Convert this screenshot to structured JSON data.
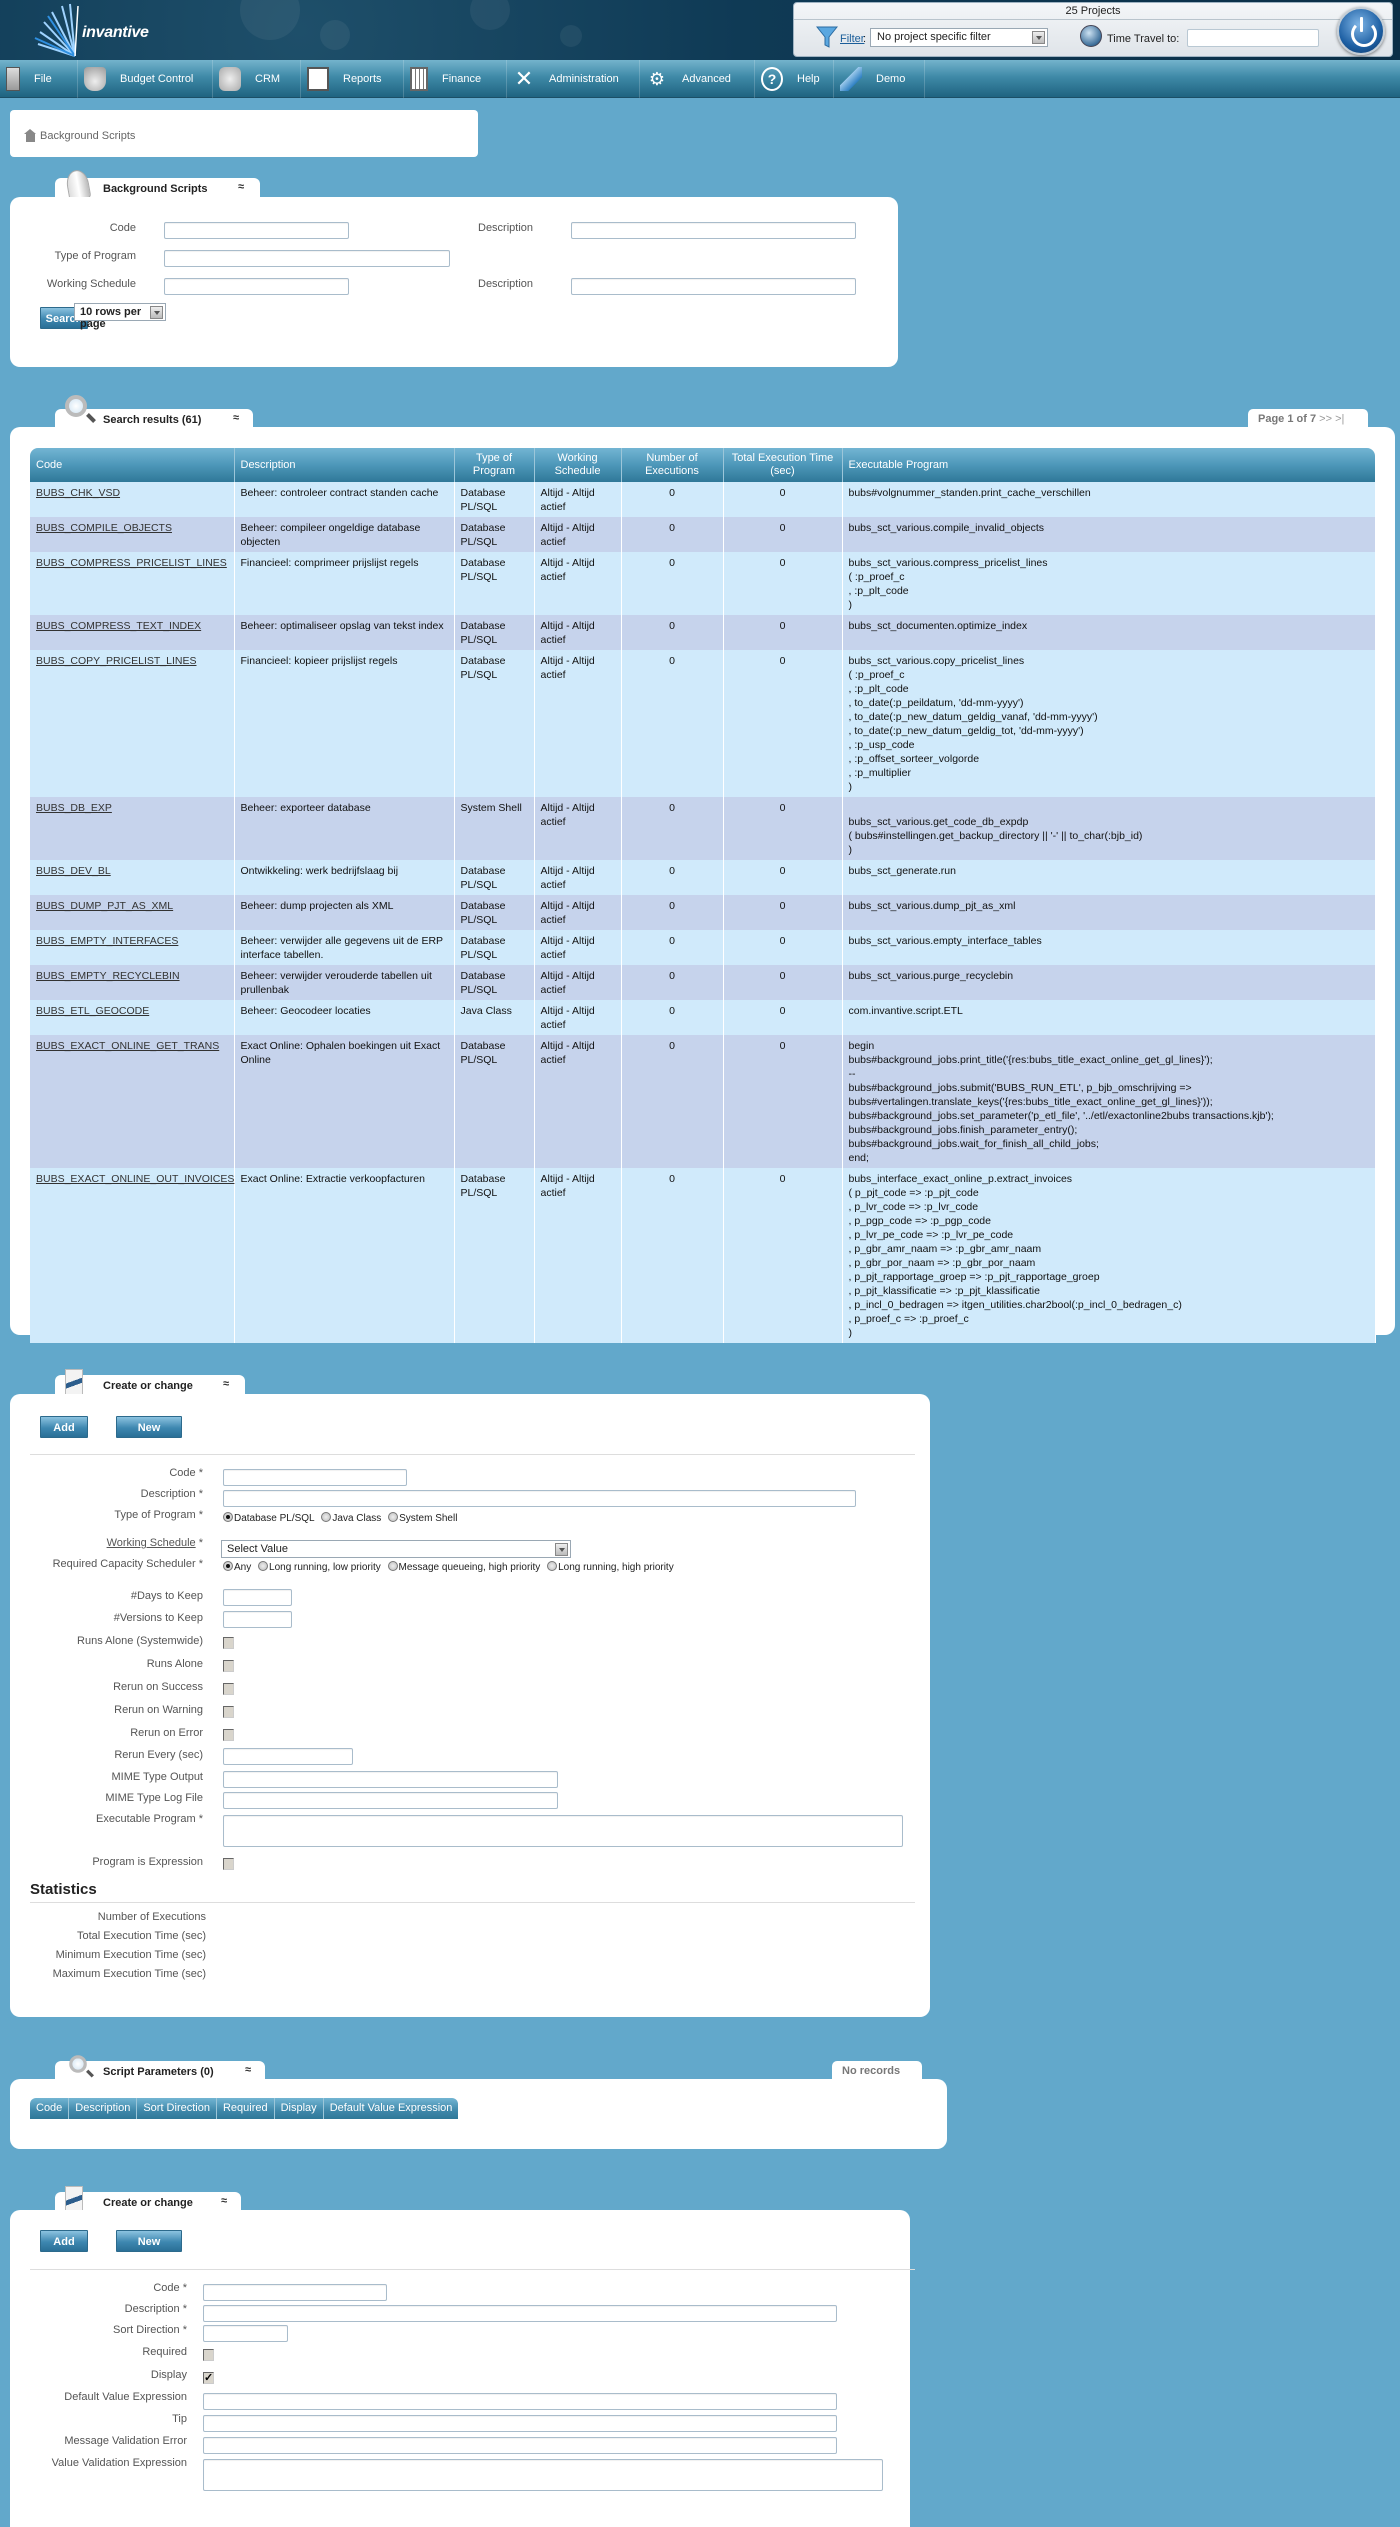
{
  "header": {
    "logo_text": "invantive",
    "projects_count": "25 Projects",
    "filter_label": "Filter",
    "filter_colon": ":",
    "filter_value": "No project specific filter",
    "time_travel_label": "Time Travel to:",
    "time_travel_value": ""
  },
  "nav": {
    "items": [
      {
        "label": "File",
        "icon": "file-cabinet-icon"
      },
      {
        "label": "Budget Control",
        "icon": "money-bag-icon"
      },
      {
        "label": "CRM",
        "icon": "handshake-icon"
      },
      {
        "label": "Reports",
        "icon": "presentation-chart-icon"
      },
      {
        "label": "Finance",
        "icon": "calculator-icon"
      },
      {
        "label": "Administration",
        "icon": "tools-icon"
      },
      {
        "label": "Advanced",
        "icon": "gears-icon"
      },
      {
        "label": "Help",
        "icon": "help-icon"
      },
      {
        "label": "Demo",
        "icon": "demo-logo-icon"
      }
    ]
  },
  "breadcrumb": {
    "label": "Background Scripts"
  },
  "search_panel": {
    "tab_title": "Background Scripts",
    "collapse": "≈",
    "fields": {
      "code_label": "Code",
      "code_value": "",
      "description_label": "Description",
      "description_value": "",
      "type_label": "Type of Program",
      "type_value": "",
      "schedule_label": "Working Schedule",
      "schedule_value": "",
      "schedule_desc_label": "Description",
      "schedule_desc_value": ""
    },
    "search_button": "Search",
    "rows_per_page": "10 rows per page"
  },
  "results": {
    "tab_title": "Search results (61)",
    "collapse": "≈",
    "pager_text": "Page 1 of 7",
    "pager_next": ">>",
    "pager_last": ">|",
    "columns": [
      "Code",
      "Description",
      "Type of Program",
      "Working Schedule",
      "Number of Executions",
      "Total Execution Time (sec)",
      "Executable Program"
    ],
    "rows": [
      {
        "code": "BUBS_CHK_VSD",
        "description": "Beheer: controleer contract standen cache",
        "type": "Database PL/SQL",
        "schedule": "Altijd - Altijd actief",
        "executions": "0",
        "total_time": "0",
        "program": [
          "bubs#volgnummer_standen.print_cache_verschillen"
        ]
      },
      {
        "code": "BUBS_COMPILE_OBJECTS",
        "description": "Beheer: compileer ongeldige database objecten",
        "type": "Database PL/SQL",
        "schedule": "Altijd - Altijd actief",
        "executions": "0",
        "total_time": "0",
        "program": [
          "bubs_sct_various.compile_invalid_objects"
        ]
      },
      {
        "code": "BUBS_COMPRESS_PRICELIST_LINES",
        "description": "Financieel: comprimeer prijslijst regels",
        "type": "Database PL/SQL",
        "schedule": "Altijd - Altijd actief",
        "executions": "0",
        "total_time": "0",
        "program": [
          "bubs_sct_various.compress_pricelist_lines",
          "( :p_proef_c",
          ", :p_plt_code",
          ")"
        ]
      },
      {
        "code": "BUBS_COMPRESS_TEXT_INDEX",
        "description": "Beheer: optimaliseer opslag van tekst index",
        "type": "Database PL/SQL",
        "schedule": "Altijd - Altijd actief",
        "executions": "0",
        "total_time": "0",
        "program": [
          "bubs_sct_documenten.optimize_index"
        ]
      },
      {
        "code": "BUBS_COPY_PRICELIST_LINES",
        "description": "Financieel: kopieer prijslijst regels",
        "type": "Database PL/SQL",
        "schedule": "Altijd - Altijd actief",
        "executions": "0",
        "total_time": "0",
        "program": [
          "bubs_sct_various.copy_pricelist_lines",
          "( :p_proef_c",
          ", :p_plt_code",
          ", to_date(:p_peildatum, 'dd-mm-yyyy')",
          ", to_date(:p_new_datum_geldig_vanaf, 'dd-mm-yyyy')",
          ", to_date(:p_new_datum_geldig_tot, 'dd-mm-yyyy')",
          ", :p_usp_code",
          ", :p_offset_sorteer_volgorde",
          ", :p_multiplier",
          ")"
        ]
      },
      {
        "code": "BUBS_DB_EXP",
        "description": "Beheer: exporteer database",
        "type": "System Shell",
        "schedule": "Altijd - Altijd actief",
        "executions": "0",
        "total_time": "0",
        "program": [
          "",
          "bubs_sct_various.get_code_db_expdp",
          "( bubs#instellingen.get_backup_directory || '-' || to_char(:bjb_id)",
          ")"
        ]
      },
      {
        "code": "BUBS_DEV_BL",
        "description": "Ontwikkeling: werk bedrijfslaag bij",
        "type": "Database PL/SQL",
        "schedule": "Altijd - Altijd actief",
        "executions": "0",
        "total_time": "0",
        "program": [
          "bubs_sct_generate.run"
        ]
      },
      {
        "code": "BUBS_DUMP_PJT_AS_XML",
        "description": "Beheer: dump projecten als XML",
        "type": "Database PL/SQL",
        "schedule": "Altijd - Altijd actief",
        "executions": "0",
        "total_time": "0",
        "program": [
          "bubs_sct_various.dump_pjt_as_xml"
        ]
      },
      {
        "code": "BUBS_EMPTY_INTERFACES",
        "description": "Beheer: verwijder alle gegevens uit de ERP interface tabellen.",
        "type": "Database PL/SQL",
        "schedule": "Altijd - Altijd actief",
        "executions": "0",
        "total_time": "0",
        "program": [
          "bubs_sct_various.empty_interface_tables"
        ]
      },
      {
        "code": "BUBS_EMPTY_RECYCLEBIN",
        "description": "Beheer: verwijder verouderde tabellen uit prullenbak",
        "type": "Database PL/SQL",
        "schedule": "Altijd - Altijd actief",
        "executions": "0",
        "total_time": "0",
        "program": [
          "bubs_sct_various.purge_recyclebin"
        ]
      },
      {
        "code": "BUBS_ETL_GEOCODE",
        "description": "Beheer: Geocodeer locaties",
        "type": "Java Class",
        "schedule": "Altijd - Altijd actief",
        "executions": "0",
        "total_time": "0",
        "program": [
          "com.invantive.script.ETL"
        ]
      },
      {
        "code": "BUBS_EXACT_ONLINE_GET_TRANS",
        "description": "Exact Online: Ophalen boekingen uit Exact Online",
        "type": "Database PL/SQL",
        "schedule": "Altijd - Altijd actief",
        "executions": "0",
        "total_time": "0",
        "program": [
          "begin",
          "bubs#background_jobs.print_title('{res:bubs_title_exact_online_get_gl_lines}');",
          "--",
          "bubs#background_jobs.submit('BUBS_RUN_ETL', p_bjb_omschrijving =>",
          "bubs#vertalingen.translate_keys('{res:bubs_title_exact_online_get_gl_lines}'));",
          "bubs#background_jobs.set_parameter('p_etl_file', '../etl/exactonline2bubs transactions.kjb');",
          "bubs#background_jobs.finish_parameter_entry();",
          "bubs#background_jobs.wait_for_finish_all_child_jobs;",
          "end;"
        ]
      },
      {
        "code": "BUBS_EXACT_ONLINE_OUT_INVOICES",
        "description": "Exact Online: Extractie verkoopfacturen",
        "type": "Database PL/SQL",
        "schedule": "Altijd - Altijd actief",
        "executions": "0",
        "total_time": "0",
        "program": [
          "bubs_interface_exact_online_p.extract_invoices",
          "( p_pjt_code => :p_pjt_code",
          ", p_lvr_code => :p_lvr_code",
          ", p_pgp_code => :p_pgp_code",
          ", p_lvr_pe_code => :p_lvr_pe_code",
          ", p_gbr_amr_naam => :p_gbr_amr_naam",
          ", p_gbr_por_naam => :p_gbr_por_naam",
          ", p_pjt_rapportage_groep => :p_pjt_rapportage_groep",
          ", p_pjt_klassificatie => :p_pjt_klassificatie",
          ", p_incl_0_bedragen => itgen_utilities.char2bool(:p_incl_0_bedragen_c)",
          ", p_proef_c => :p_proef_c",
          ")"
        ]
      }
    ]
  },
  "edit_form": {
    "tab_title": "Create or change",
    "collapse": "≈",
    "add_button": "Add",
    "new_button": "New",
    "code_label": "Code *",
    "description_label": "Description *",
    "type_label": "Type of Program *",
    "type_options": [
      {
        "label": "Database PL/SQL",
        "selected": true
      },
      {
        "label": "Java Class",
        "selected": false
      },
      {
        "label": "System Shell",
        "selected": false
      }
    ],
    "schedule_label": "Working Schedule",
    "schedule_required": " *",
    "schedule_value": "Select Value",
    "capacity_label": "Required Capacity Scheduler *",
    "capacity_options": [
      {
        "label": "Any",
        "selected": true
      },
      {
        "label": "Long running, low priority",
        "selected": false
      },
      {
        "label": "Message queueing, high priority",
        "selected": false
      },
      {
        "label": "Long running, high priority",
        "selected": false
      }
    ],
    "days_label": "#Days to Keep",
    "versions_label": "#Versions to Keep",
    "runs_alone_sys_label": "Runs Alone (Systemwide)",
    "runs_alone_sys_checked": false,
    "runs_alone_label": "Runs Alone",
    "runs_alone_checked": false,
    "rerun_success_label": "Rerun on Success",
    "rerun_success_checked": false,
    "rerun_warning_label": "Rerun on Warning",
    "rerun_warning_checked": false,
    "rerun_error_label": "Rerun on Error",
    "rerun_error_checked": false,
    "rerun_every_label": "Rerun Every (sec)",
    "mime_output_label": "MIME Type Output",
    "mime_log_label": "MIME Type Log File",
    "exec_program_label": "Executable Program *",
    "program_expr_label": "Program is Expression",
    "program_expr_checked": false,
    "statistics_title": "Statistics",
    "stats": {
      "executions_label": "Number of Executions",
      "total_label": "Total Execution Time (sec)",
      "min_label": "Minimum Execution Time (sec)",
      "max_label": "Maximum Execution Time (sec)"
    }
  },
  "params": {
    "tab_title": "Script Parameters (0)",
    "collapse": "≈",
    "no_records": "No records",
    "columns": [
      "Code",
      "Description",
      "Sort Direction",
      "Required",
      "Display",
      "Default Value Expression"
    ]
  },
  "param_form": {
    "tab_title": "Create or change",
    "collapse": "≈",
    "add_button": "Add",
    "new_button": "New",
    "code_label": "Code *",
    "description_label": "Description *",
    "sort_label": "Sort Direction *",
    "required_label": "Required",
    "required_checked": false,
    "display_label": "Display",
    "display_checked": true,
    "default_label": "Default Value Expression",
    "tip_label": "Tip",
    "msg_label": "Message Validation Error",
    "valexpr_label": "Value Validation Expression"
  }
}
